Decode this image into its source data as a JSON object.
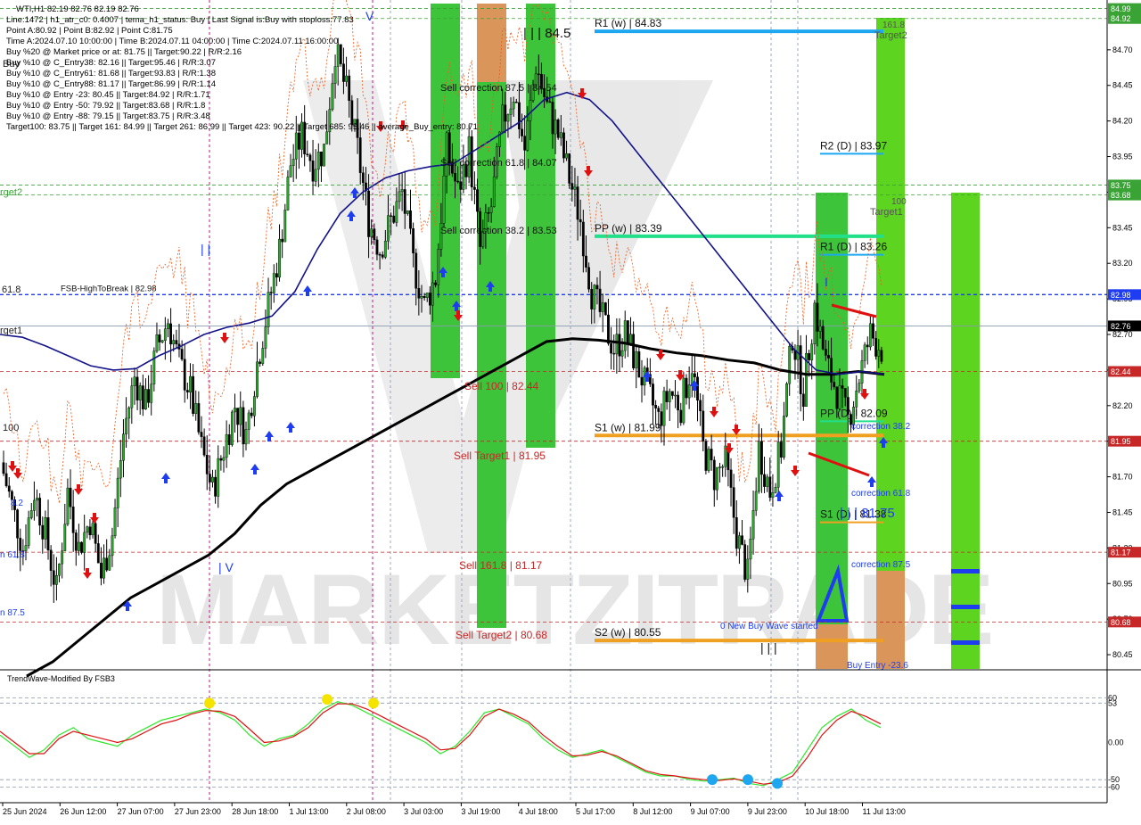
{
  "header": {
    "symbol_line": "WTI,H1  82.19 82.76 82.19 82.76",
    "info_lines": [
      "Line:1472 | h1_atr_c0: 0.4007 | tema_h1_status: Buy | Last Signal is:Buy with stoploss:77.83",
      "Point A:80.92 | Point B:82.92 | Point C:81.75",
      "Time A:2024.07.10 10:00:00 | Time B:2024.07.11 04:00:00 | Time C:2024.07.11 16:00:00",
      "Buy %20 @ Market price or at: 81.75 || Target:90.22 | R/R:2.16",
      "Buy %10 @ C_Entry38: 82.16 || Target:95.46 | R/R:3.07",
      "Buy %10 @ C_Entry61: 81.68 || Target:93.83 | R/R:1.38",
      "Buy %10 @ C_Entry88: 81.17 || Target:86.99 | R/R:1.14",
      "Buy %10 @ Entry -23: 80.45 || Target:84.92 | R/R:1.71",
      "Buy %10 @ Entry -50: 79.92 || Target:83.68 | R/R:1.8",
      "Buy %10 @ Entry -88: 79.15 || Target:83.75 | R/R:3.48",
      "Target100: 83.75 || Target 161: 84.99 || Target 261: 86.99 || Target 423: 90.22 || Target 685: 95.46 || average_Buy_entry: 80.71"
    ]
  },
  "price_axis": {
    "ticks": [
      "84.70",
      "84.45",
      "84.20",
      "83.95",
      "83.70",
      "83.45",
      "83.20",
      "82.95",
      "82.70",
      "82.45",
      "82.20",
      "81.95",
      "81.70",
      "81.45",
      "81.20",
      "80.95",
      "80.70",
      "80.45"
    ],
    "tags": [
      {
        "value": "84.99",
        "bg": "#3aa335"
      },
      {
        "value": "84.92",
        "bg": "#3aa335"
      },
      {
        "value": "83.75",
        "bg": "#3aa335"
      },
      {
        "value": "83.68",
        "bg": "#3aa335"
      },
      {
        "value": "82.98",
        "bg": "#1e3df0"
      },
      {
        "value": "82.76",
        "bg": "#000000"
      },
      {
        "value": "82.44",
        "bg": "#c62828"
      },
      {
        "value": "81.95",
        "bg": "#c62828"
      },
      {
        "value": "81.17",
        "bg": "#c62828"
      },
      {
        "value": "80.68",
        "bg": "#c62828"
      }
    ]
  },
  "time_axis": [
    "25 Jun 2024",
    "26 Jun 12:00",
    "27 Jun 07:00",
    "27 Jun 23:00",
    "28 Jun 18:00",
    "1 Jul 13:00",
    "2 Jul 08:00",
    "3 Jul 03:00",
    "3 Jul 19:00",
    "4 Jul 18:00",
    "5 Jul 17:00",
    "8 Jul 12:00",
    "9 Jul 07:00",
    "9 Jul 23:00",
    "10 Jul 18:00",
    "11 Jul 13:00"
  ],
  "levels": [
    {
      "text": "R1 (w) | 84.83",
      "price": 84.83,
      "color": "#1ea7f0"
    },
    {
      "text": "R2 (D) | 83.97",
      "price": 83.97,
      "color": "#1ea7f0"
    },
    {
      "text": "PP (w) | 83.39",
      "price": 83.39,
      "color": "#22e08a"
    },
    {
      "text": "R1 (D) | 83.26",
      "price": 83.26,
      "color": "#1ea7f0"
    },
    {
      "text": "FSB-HighToBreak | 82.98",
      "price": 82.98,
      "color": "#1e2fd0"
    },
    {
      "text": "PP (D) | 82.09",
      "price": 82.09,
      "color": "#22e08a"
    },
    {
      "text": "S1 (w) | 81.99",
      "price": 81.99,
      "color": "#f0a020"
    },
    {
      "text": "S1 (D) | 81.38",
      "price": 81.38,
      "color": "#f0a020"
    },
    {
      "text": "S2 (w) | 80.55",
      "price": 80.55,
      "color": "#f0a020"
    }
  ],
  "annotations": {
    "sell_correction_875": "Sell correction 87.5 | 84.54",
    "sell_correction_618": "Sell correction 61.8 | 84.07",
    "sell_correction_382": "Sell correction 38.2 | 83.53",
    "sell_100": "Sell 100 | 82.44",
    "sell_target1": "Sell Target1 | 81.95",
    "sell_1618": "Sell 161.8 | 81.17",
    "sell_target2": "Sell Target2 | 80.68",
    "wave_top": "| | | 84.5",
    "wave_right": "| | | 81.75",
    "new_buy_wave": "0 New Buy Wave started",
    "correction_382": "correction 38.2",
    "correction_618": "correction 61.8",
    "correction_875": "correction 87.5",
    "target1": "Target1",
    "target2": "Target2",
    "t100": "100",
    "t1618": "161.8",
    "buy_entry": "Buy Entry -23.6",
    "left_618": "61.8",
    "left_target1": "rget1",
    "left_target2": "rget2",
    "left_buy": "Buy",
    "left_100": "100",
    "left_382": "8.2",
    "left_618b": "n 61.8",
    "left_875": "n 87.5",
    "roman_ii": "| |",
    "roman_iv": "| V",
    "roman_v": "V",
    "roman_i": "I",
    "roman_iii": "| | |",
    "watermark": "MARKETZITRADE"
  },
  "oscillator": {
    "title": "TrendWave-Modified By FSB3",
    "axis_labels": [
      "60",
      "53",
      "0.00",
      "-50",
      "-60"
    ]
  },
  "chart_data": {
    "type": "candlestick",
    "symbol": "WTI",
    "timeframe": "H1",
    "ohlc_last": {
      "open": 82.19,
      "high": 82.76,
      "low": 82.19,
      "close": 82.76
    },
    "ylim": [
      80.35,
      85.05
    ],
    "current_price": 82.76,
    "close_path": [
      81.8,
      81.5,
      81.2,
      81.6,
      81.3,
      80.9,
      81.6,
      81.2,
      81.4,
      81.0,
      81.3,
      82.0,
      82.4,
      82.2,
      82.6,
      82.8,
      82.5,
      82.3,
      81.9,
      81.6,
      81.9,
      82.2,
      82.0,
      82.5,
      82.9,
      83.3,
      83.9,
      84.1,
      83.9,
      84.0,
      84.7,
      84.4,
      84.0,
      83.5,
      83.3,
      83.5,
      83.7,
      83.2,
      82.9,
      83.1,
      84.0,
      83.7,
      84.0,
      83.3,
      83.6,
      84.2,
      84.4,
      84.0,
      84.6,
      84.3,
      84.1,
      83.8,
      83.5,
      83.0,
      82.8,
      82.6,
      82.7,
      82.5,
      82.3,
      82.1,
      82.3,
      82.2,
      82.5,
      81.9,
      81.7,
      81.8,
      81.3,
      81.0,
      81.9,
      81.6,
      81.9,
      82.7,
      82.3,
      82.9,
      82.5,
      82.3,
      82.1,
      82.4,
      82.7,
      82.6
    ],
    "ema_fast_path": [
      82.7,
      82.68,
      82.62,
      82.55,
      82.48,
      82.45,
      82.46,
      82.55,
      82.62,
      82.7,
      82.75,
      82.78,
      82.83,
      83.0,
      83.3,
      83.55,
      83.7,
      83.8,
      83.85,
      83.88,
      83.9,
      84.0,
      84.1,
      84.2,
      84.35,
      84.4,
      84.35,
      84.2,
      84.0,
      83.8,
      83.6,
      83.4,
      83.2,
      83.0,
      82.8,
      82.6,
      82.45,
      82.42,
      82.44,
      82.42
    ],
    "ema_slow_path": [
      80.3,
      80.4,
      80.55,
      80.7,
      80.85,
      80.95,
      81.05,
      81.15,
      81.3,
      81.5,
      81.65,
      81.75,
      81.85,
      81.95,
      82.05,
      82.15,
      82.25,
      82.35,
      82.45,
      82.55,
      82.65,
      82.67,
      82.66,
      82.64,
      82.6,
      82.57,
      82.55,
      82.52,
      82.5,
      82.45,
      82.42,
      82.42,
      82.44,
      82.42
    ],
    "oscillator": {
      "ylim": [
        -75,
        75
      ],
      "green_path": [
        10,
        -5,
        -20,
        -10,
        10,
        20,
        5,
        0,
        -5,
        10,
        20,
        30,
        35,
        40,
        45,
        40,
        30,
        10,
        -5,
        5,
        10,
        25,
        45,
        55,
        50,
        40,
        30,
        20,
        10,
        0,
        -15,
        -5,
        15,
        40,
        45,
        35,
        25,
        5,
        -10,
        -20,
        -15,
        -10,
        -20,
        -30,
        -40,
        -45,
        -45,
        -50,
        -52,
        -50,
        -48,
        -55,
        -58,
        -50,
        -40,
        -10,
        20,
        35,
        45,
        30,
        20
      ],
      "red_path": [
        15,
        0,
        -15,
        -15,
        5,
        15,
        10,
        5,
        0,
        5,
        15,
        25,
        30,
        38,
        43,
        42,
        35,
        18,
        0,
        2,
        8,
        20,
        40,
        52,
        52,
        45,
        35,
        25,
        15,
        5,
        -10,
        -8,
        10,
        35,
        45,
        38,
        28,
        10,
        -5,
        -18,
        -17,
        -12,
        -18,
        -28,
        -38,
        -43,
        -45,
        -48,
        -50,
        -51,
        -49,
        -52,
        -56,
        -54,
        -45,
        -20,
        10,
        30,
        42,
        35,
        25
      ],
      "markers": [
        {
          "type": "top",
          "color": "#f5e400",
          "value": 53
        },
        {
          "type": "top",
          "color": "#f5e400",
          "value": 58
        },
        {
          "type": "top",
          "color": "#f5e400",
          "value": 53
        },
        {
          "type": "bottom",
          "color": "#1ea7f0",
          "value": -50
        },
        {
          "type": "bottom",
          "color": "#1ea7f0",
          "value": -50
        },
        {
          "type": "bottom",
          "color": "#1ea7f0",
          "value": -55
        }
      ]
    }
  }
}
